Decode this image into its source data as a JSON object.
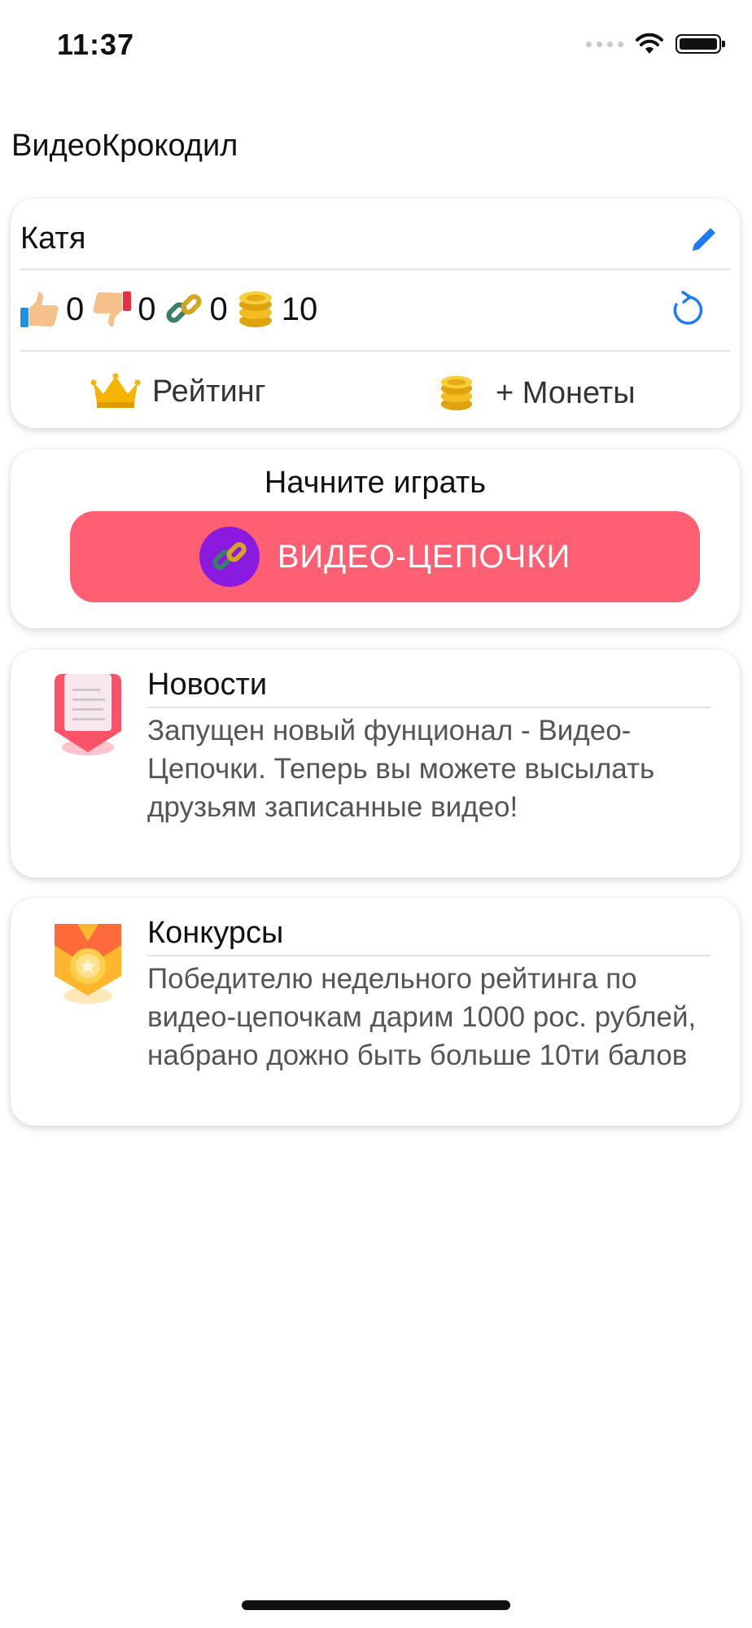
{
  "status_bar": {
    "time": "11:37"
  },
  "app": {
    "title": "ВидеоКрокодил"
  },
  "profile": {
    "name": "Катя",
    "stats": {
      "likes": "0",
      "dislikes": "0",
      "chains": "0",
      "coins": "10"
    },
    "rating_label": "Рейтинг",
    "coins_label": "+ Монеты"
  },
  "play": {
    "title": "Начните играть",
    "button_label": "ВИДЕО-ЦЕПОЧКИ"
  },
  "news": {
    "title": "Новости",
    "body": "Запущен новый фунционал - Видео-Цепочки. Теперь вы можете высылать друзьям записанные видео!"
  },
  "contests": {
    "title": "Конкурсы",
    "body": "Победителю недельного рейтинга по видео-цепочкам дарим 1000 рос. рублей, набрано дожно быть больше 10ти балов"
  },
  "colors": {
    "accent": "#fe5f73",
    "link_blue": "#1e7cf2",
    "badge_purple": "#8a1adf"
  },
  "icons": [
    "thumbs-up-icon",
    "thumbs-down-icon",
    "chain-icon",
    "coins-icon",
    "edit-icon",
    "refresh-icon",
    "crown-icon",
    "scroll-icon",
    "medal-icon"
  ]
}
